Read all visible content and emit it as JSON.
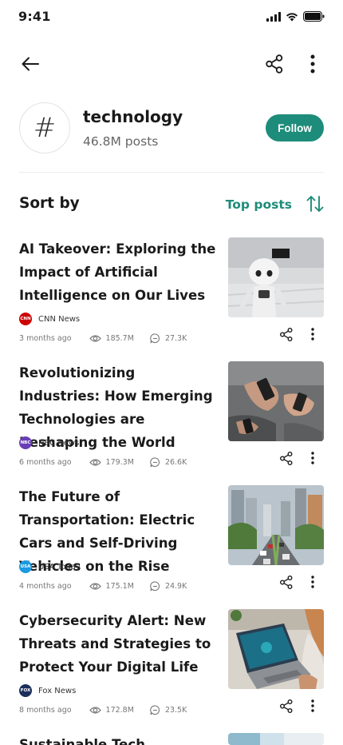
{
  "status": {
    "time": "9:41"
  },
  "topic": {
    "symbol": "#",
    "name": "technology",
    "count": "46.8M posts",
    "follow_label": "Follow"
  },
  "sort": {
    "label": "Sort by",
    "value": "Top posts"
  },
  "colors": {
    "accent": "#1e8c7a",
    "text": "#1a1a1a",
    "muted": "#777777"
  },
  "articles": [
    {
      "title": "AI Takeover: Exploring the Impact of Artificial Intelligence on Our Lives",
      "source": "CNN News",
      "logo_text": "CNN",
      "logo_color": "#cc0000",
      "age": "3 months ago",
      "views": "185.7M",
      "comments": "27.3K"
    },
    {
      "title": "Revolutionizing Industries: How Emerging Technologies are Reshaping the World",
      "source": "NBC News",
      "logo_text": "NBC",
      "logo_color": "#6a3fb5",
      "age": "6 months ago",
      "views": "179.3M",
      "comments": "26.6K"
    },
    {
      "title": "The Future of Transportation: Electric Cars and Self-Driving Vehicles on the Rise",
      "source": "USA Today",
      "logo_text": "USA",
      "logo_color": "#1a9ae0",
      "age": "4 months ago",
      "views": "175.1M",
      "comments": "24.9K"
    },
    {
      "title": "Cybersecurity Alert: New Threats and Strategies to Protect Your Digital Life",
      "source": "Fox News",
      "logo_text": "FOX",
      "logo_color": "#1b2f5c",
      "age": "8 months ago",
      "views": "172.8M",
      "comments": "23.5K"
    },
    {
      "title": "Sustainable Tech Solutions:",
      "source": "",
      "logo_text": "",
      "logo_color": "#888888",
      "age": "",
      "views": "",
      "comments": ""
    }
  ]
}
